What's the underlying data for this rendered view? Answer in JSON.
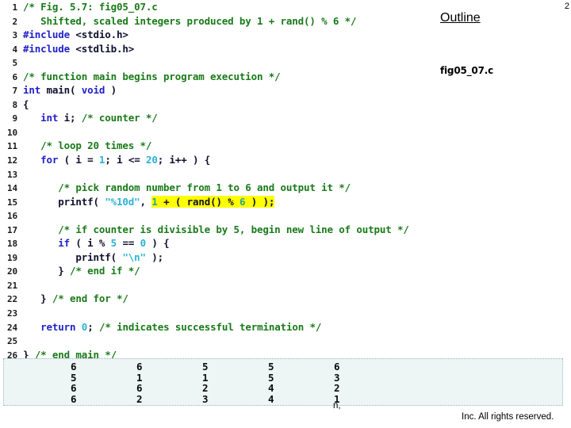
{
  "slide": {
    "page_number": "2",
    "background_color": "#ffffff"
  },
  "outline": {
    "title": "Outline",
    "entry": "fig05_07.c"
  },
  "footer": {
    "copyright_fragment": "n,",
    "copyright_line": "Inc.  All rights reserved."
  },
  "colors": {
    "comment": "#1a7a1a",
    "keyword": "#2121c8",
    "preprocessor": "#2121c8",
    "string": "#2bb2d6",
    "number": "#2bb2d6",
    "highlight": "#ffff00",
    "output_background": "#edf5f5",
    "output_border": "#9fb4bd"
  },
  "code": {
    "file_name": "fig05_07.c",
    "lines": [
      {
        "n": "1",
        "tokens": [
          {
            "t": "/* Fig. 5.7: fig05_07.c",
            "c": "comment"
          }
        ]
      },
      {
        "n": "2",
        "tokens": [
          {
            "t": "   Shifted, scaled integers produced by 1 + rand() % 6 */",
            "c": "comment"
          }
        ]
      },
      {
        "n": "3",
        "tokens": [
          {
            "t": "#include",
            "c": "pre"
          },
          {
            "t": " ",
            "c": "plain"
          },
          {
            "t": "<stdio.h>",
            "c": "plain"
          }
        ]
      },
      {
        "n": "4",
        "tokens": [
          {
            "t": "#include",
            "c": "pre"
          },
          {
            "t": " ",
            "c": "plain"
          },
          {
            "t": "<stdlib.h>",
            "c": "plain"
          }
        ]
      },
      {
        "n": "5",
        "tokens": [
          {
            "t": "",
            "c": "plain"
          }
        ]
      },
      {
        "n": "6",
        "tokens": [
          {
            "t": "/* function main begins program execution */",
            "c": "comment"
          }
        ]
      },
      {
        "n": "7",
        "tokens": [
          {
            "t": "int",
            "c": "kw"
          },
          {
            "t": " main( ",
            "c": "plain"
          },
          {
            "t": "void",
            "c": "kw"
          },
          {
            "t": " )",
            "c": "plain"
          }
        ]
      },
      {
        "n": "8",
        "tokens": [
          {
            "t": "{",
            "c": "plain"
          }
        ]
      },
      {
        "n": "9",
        "tokens": [
          {
            "t": "   ",
            "c": "plain"
          },
          {
            "t": "int",
            "c": "kw"
          },
          {
            "t": " i; ",
            "c": "plain"
          },
          {
            "t": "/* counter */",
            "c": "comment"
          }
        ]
      },
      {
        "n": "10",
        "tokens": [
          {
            "t": "",
            "c": "plain"
          }
        ]
      },
      {
        "n": "11",
        "tokens": [
          {
            "t": "   ",
            "c": "plain"
          },
          {
            "t": "/* loop 20 times */",
            "c": "comment"
          }
        ]
      },
      {
        "n": "12",
        "tokens": [
          {
            "t": "   ",
            "c": "plain"
          },
          {
            "t": "for",
            "c": "kw"
          },
          {
            "t": " ( i = ",
            "c": "plain"
          },
          {
            "t": "1",
            "c": "num"
          },
          {
            "t": "; i <= ",
            "c": "plain"
          },
          {
            "t": "20",
            "c": "num"
          },
          {
            "t": "; i++ ) {",
            "c": "plain"
          }
        ]
      },
      {
        "n": "13",
        "tokens": [
          {
            "t": "",
            "c": "plain"
          }
        ]
      },
      {
        "n": "14",
        "tokens": [
          {
            "t": "      ",
            "c": "plain"
          },
          {
            "t": "/* pick random number from 1 to 6 and output it */",
            "c": "comment"
          }
        ]
      },
      {
        "n": "15",
        "tokens": [
          {
            "t": "      printf( ",
            "c": "plain"
          },
          {
            "t": "\"%10d\"",
            "c": "str"
          },
          {
            "t": ", ",
            "c": "plain"
          },
          {
            "t": "1",
            "c": "num-hl",
            "h": true
          },
          {
            "t": " + ( rand() % ",
            "c": "plain",
            "h": true
          },
          {
            "t": "6",
            "c": "num-hl",
            "h": true
          },
          {
            "t": " ) );",
            "c": "plain",
            "h": true
          }
        ]
      },
      {
        "n": "16",
        "tokens": [
          {
            "t": "",
            "c": "plain"
          }
        ]
      },
      {
        "n": "17",
        "tokens": [
          {
            "t": "      ",
            "c": "plain"
          },
          {
            "t": "/* if counter is divisible by 5, begin new line of output */",
            "c": "comment"
          }
        ]
      },
      {
        "n": "18",
        "tokens": [
          {
            "t": "      ",
            "c": "plain"
          },
          {
            "t": "if",
            "c": "kw"
          },
          {
            "t": " ( i % ",
            "c": "plain"
          },
          {
            "t": "5",
            "c": "num"
          },
          {
            "t": " == ",
            "c": "plain"
          },
          {
            "t": "0",
            "c": "num"
          },
          {
            "t": " ) {",
            "c": "plain"
          }
        ]
      },
      {
        "n": "19",
        "tokens": [
          {
            "t": "         printf( ",
            "c": "plain"
          },
          {
            "t": "\"\\n\"",
            "c": "str"
          },
          {
            "t": " );",
            "c": "plain"
          }
        ]
      },
      {
        "n": "20",
        "tokens": [
          {
            "t": "      } ",
            "c": "plain"
          },
          {
            "t": "/* end if */",
            "c": "comment"
          }
        ]
      },
      {
        "n": "21",
        "tokens": [
          {
            "t": "",
            "c": "plain"
          }
        ]
      },
      {
        "n": "22",
        "tokens": [
          {
            "t": "   } ",
            "c": "plain"
          },
          {
            "t": "/* end for */",
            "c": "comment"
          }
        ]
      },
      {
        "n": "23",
        "tokens": [
          {
            "t": "",
            "c": "plain"
          }
        ]
      },
      {
        "n": "24",
        "tokens": [
          {
            "t": "   ",
            "c": "plain"
          },
          {
            "t": "return",
            "c": "kw"
          },
          {
            "t": " ",
            "c": "plain"
          },
          {
            "t": "0",
            "c": "num"
          },
          {
            "t": "; ",
            "c": "plain"
          },
          {
            "t": "/* indicates successful termination */",
            "c": "comment"
          }
        ]
      },
      {
        "n": "25",
        "tokens": [
          {
            "t": "",
            "c": "plain"
          }
        ]
      },
      {
        "n": "26",
        "tokens": [
          {
            "t": "} ",
            "c": "plain"
          },
          {
            "t": "/* end main */",
            "c": "comment"
          }
        ]
      }
    ]
  },
  "program_output": {
    "columns": [
      [
        "6",
        "5",
        "6",
        "6"
      ],
      [
        "6",
        "1",
        "6",
        "2"
      ],
      [
        "5",
        "1",
        "2",
        "3"
      ],
      [
        "5",
        "5",
        "4",
        "4"
      ],
      [
        "6",
        "3",
        "2",
        "1"
      ]
    ],
    "rows": [
      [
        "6",
        "6",
        "5",
        "5",
        "6"
      ],
      [
        "5",
        "1",
        "1",
        "5",
        "3"
      ],
      [
        "6",
        "6",
        "2",
        "4",
        "2"
      ],
      [
        "6",
        "2",
        "3",
        "4",
        "1"
      ]
    ]
  }
}
